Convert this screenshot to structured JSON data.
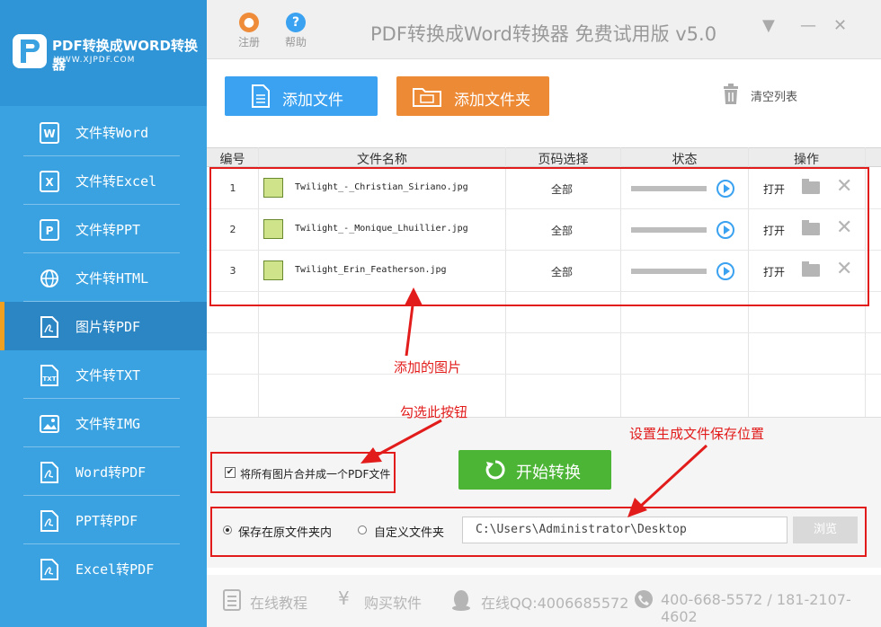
{
  "logo": {
    "title": "PDF转换成WORD转换器",
    "subtitle": "WWW.XJPDF.COM"
  },
  "sidebar": {
    "items": [
      {
        "label": "文件转Word",
        "icon": "word-icon"
      },
      {
        "label": "文件转Excel",
        "icon": "excel-icon"
      },
      {
        "label": "文件转PPT",
        "icon": "ppt-icon"
      },
      {
        "label": "文件转HTML",
        "icon": "globe-icon"
      },
      {
        "label": "图片转PDF",
        "icon": "pdf-icon",
        "active": true
      },
      {
        "label": "文件转TXT",
        "icon": "txt-icon"
      },
      {
        "label": "文件转IMG",
        "icon": "image-icon"
      },
      {
        "label": "Word转PDF",
        "icon": "pdf-icon"
      },
      {
        "label": "PPT转PDF",
        "icon": "pdf-icon"
      },
      {
        "label": "Excel转PDF",
        "icon": "pdf-icon"
      }
    ]
  },
  "titlebar": {
    "register": "注册",
    "help": "帮助",
    "title": "PDF转换成Word转换器 免费试用版 v5.0"
  },
  "toolbar": {
    "add_file": "添加文件",
    "add_folder": "添加文件夹",
    "clear": "清空列表"
  },
  "table": {
    "headers": {
      "num": "编号",
      "name": "文件名称",
      "page": "页码选择",
      "status": "状态",
      "action": "操作"
    },
    "rows": [
      {
        "num": "1",
        "name": "Twilight_-_Christian_Siriano.jpg",
        "page": "全部",
        "open": "打开"
      },
      {
        "num": "2",
        "name": "Twilight_-_Monique_Lhuillier.jpg",
        "page": "全部",
        "open": "打开"
      },
      {
        "num": "3",
        "name": "Twilight_Erin_Featherson.jpg",
        "page": "全部",
        "open": "打开"
      }
    ]
  },
  "annotations": {
    "added_images": "添加的图片",
    "check_this": "勾选此按钮",
    "set_location": "设置生成文件保存位置"
  },
  "options": {
    "merge_label": "将所有图片合并成一个PDF文件",
    "merge_checked": true,
    "start": "开始转换",
    "save_original": "保存在原文件夹内",
    "custom_folder": "自定义文件夹",
    "path": "C:\\Users\\Administrator\\Desktop",
    "browse": "浏览"
  },
  "footer": {
    "tutorial": "在线教程",
    "buy": "购买软件",
    "qq": "在线QQ:4006685572",
    "phone": "400-668-5572 / 181-2107-4602"
  },
  "colors": {
    "sidebar": "#3aa2e0",
    "add_file_btn": "#3aa2f0",
    "add_folder_btn": "#ed8a36",
    "start_btn": "#4cb536",
    "annotation": "#e21b1b"
  }
}
